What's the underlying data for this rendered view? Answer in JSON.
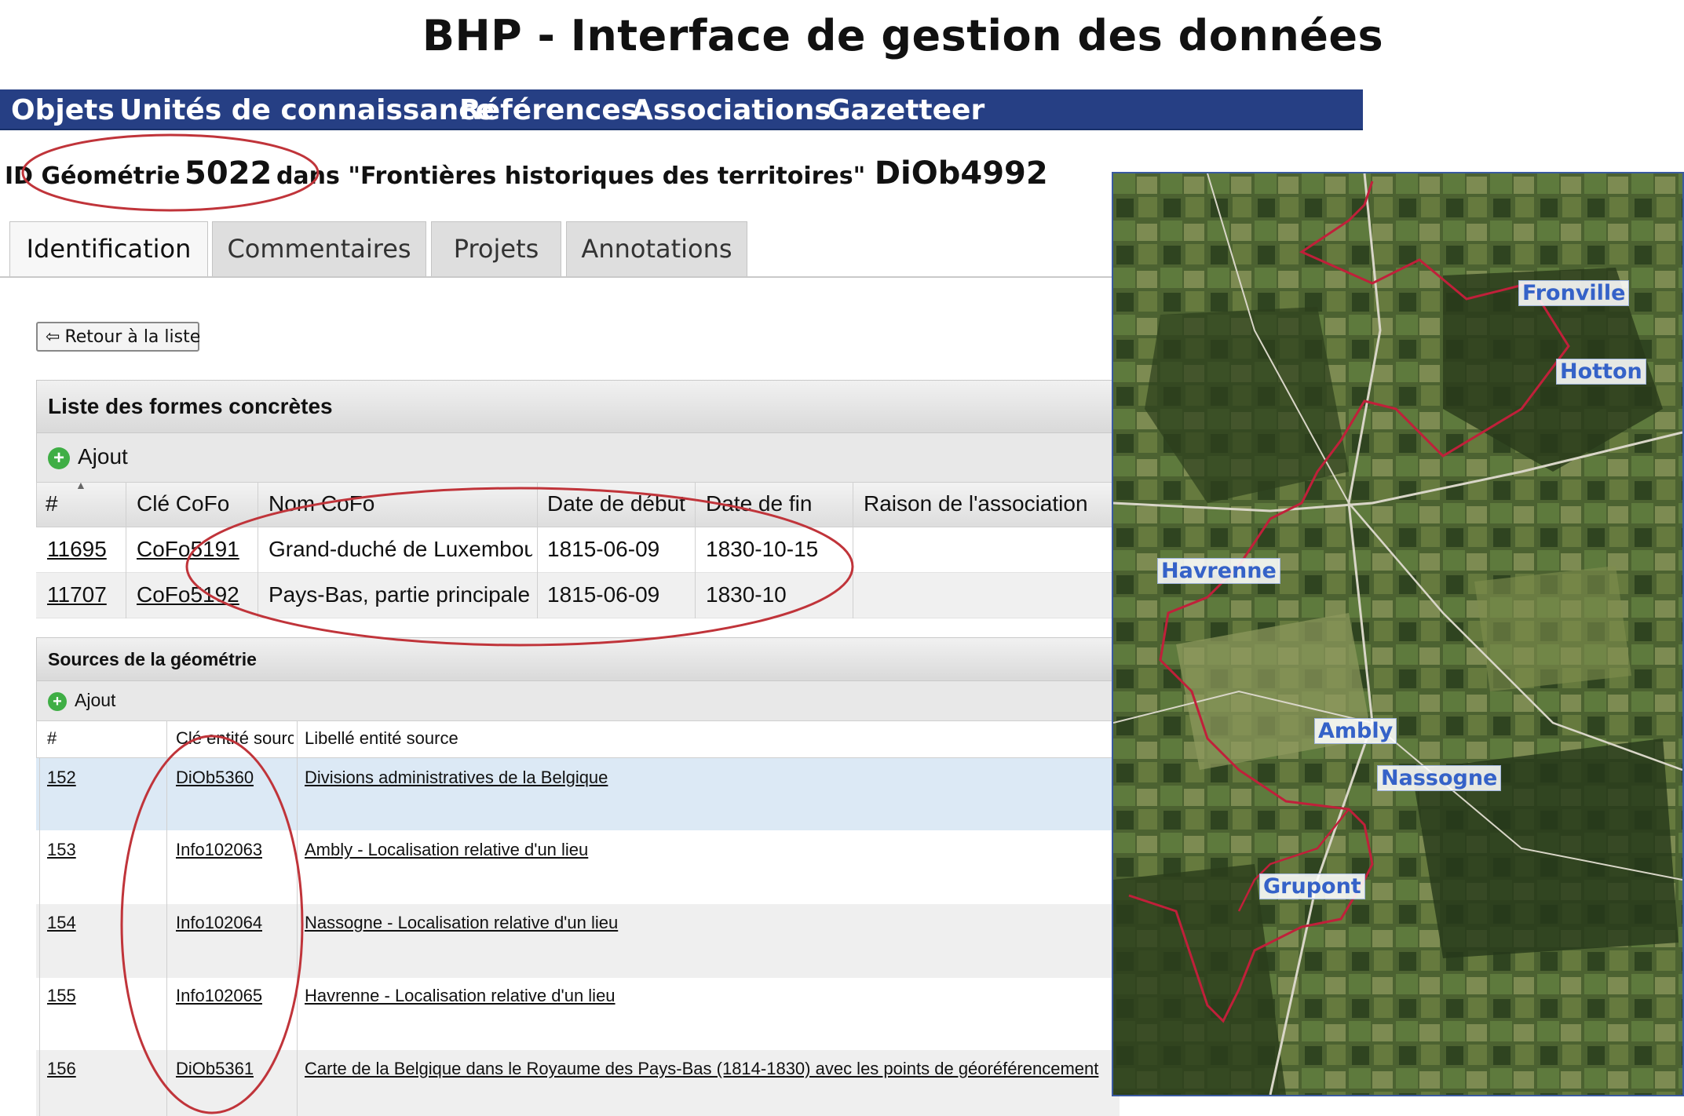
{
  "app": {
    "title": "BHP - Interface de gestion des données"
  },
  "menu": {
    "items": [
      {
        "label": "Objets"
      },
      {
        "label": "Unités de connaissance"
      },
      {
        "label": "Références"
      },
      {
        "label": "Associations"
      },
      {
        "label": "Gazetteer"
      }
    ]
  },
  "record": {
    "prefix": "ID Géométrie",
    "id": "5022",
    "middle": "dans \"Frontières historiques des territoires\"",
    "code": "DiOb4992"
  },
  "tabs": [
    {
      "label": "Identification",
      "active": true
    },
    {
      "label": "Commentaires"
    },
    {
      "label": "Projets"
    },
    {
      "label": "Annotations"
    }
  ],
  "back_button": {
    "label": "Retour à la liste"
  },
  "concrete_forms": {
    "title": "Liste des formes concrètes",
    "add_label": "Ajout",
    "columns": [
      "#",
      "Clé CoFo",
      "Nom CoFo",
      "Date de début",
      "Date de fin",
      "Raison de l'association"
    ],
    "rows": [
      {
        "num": "11695",
        "key": "CoFo5191",
        "name": "Grand-duché de Luxembourg",
        "start": "1815-06-09",
        "end": "1830-10-15",
        "reason": ""
      },
      {
        "num": "11707",
        "key": "CoFo5192",
        "name": "Pays-Bas, partie principale",
        "start": "1815-06-09",
        "end": "1830-10",
        "reason": ""
      }
    ]
  },
  "sources": {
    "title": "Sources de la géométrie",
    "add_label": "Ajout",
    "columns": [
      "#",
      "Clé entité source",
      "Libellé entité source"
    ],
    "rows": [
      {
        "num": "152",
        "key": "DiOb5360",
        "label": "Divisions administratives de la Belgique"
      },
      {
        "num": "153",
        "key": "Info102063",
        "label": "Ambly - Localisation relative d'un lieu"
      },
      {
        "num": "154",
        "key": "Info102064",
        "label": "Nassogne - Localisation relative d'un lieu"
      },
      {
        "num": "155",
        "key": "Info102065",
        "label": "Havrenne - Localisation relative d'un lieu"
      },
      {
        "num": "156",
        "key": "DiOb5361",
        "label": "Carte de la Belgique dans le Royaume des Pays-Bas (1814-1830) avec les points de géoréférencement"
      }
    ]
  },
  "map": {
    "labels": [
      "Fronville",
      "Hotton",
      "Havrenne",
      "Ambly",
      "Nassogne",
      "Grupont"
    ]
  },
  "colors": {
    "menu_bar": "#263f84",
    "annotation_ellipse": "#c0343a",
    "selected_row": "#dce9f5",
    "map_label": "#3562c8",
    "boundary": "#c0203a"
  },
  "icons": [
    "back-arrow-icon",
    "add-icon",
    "sort-arrow-icon"
  ]
}
